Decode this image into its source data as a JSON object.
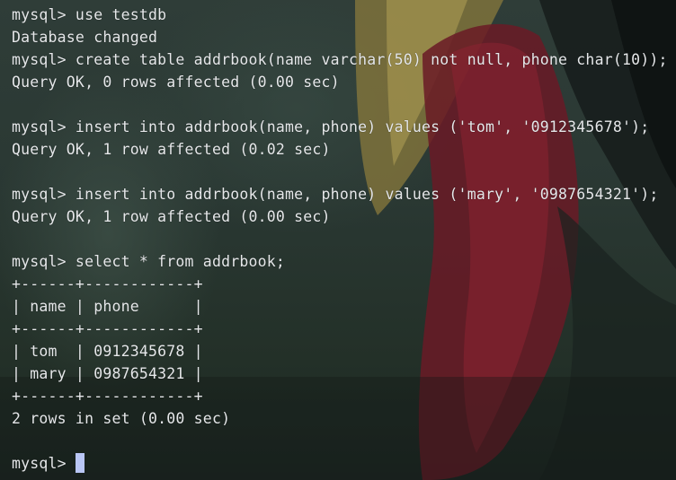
{
  "terminal": {
    "lines": [
      "mysql> use testdb",
      "Database changed",
      "mysql> create table addrbook(name varchar(50) not null, phone char(10));",
      "Query OK, 0 rows affected (0.00 sec)",
      "",
      "mysql> insert into addrbook(name, phone) values ('tom', '0912345678');",
      "Query OK, 1 row affected (0.02 sec)",
      "",
      "mysql> insert into addrbook(name, phone) values ('mary', '0987654321');",
      "Query OK, 1 row affected (0.00 sec)",
      "",
      "mysql> select * from addrbook;",
      "+------+------------+",
      "| name | phone      |",
      "+------+------------+",
      "| tom  | 0912345678 |",
      "| mary | 0987654321 |",
      "+------+------------+",
      "2 rows in set (0.00 sec)",
      ""
    ],
    "prompt": "mysql> ",
    "cursor_color": "#b9c6f5",
    "text_color": "#e6e8ea"
  }
}
